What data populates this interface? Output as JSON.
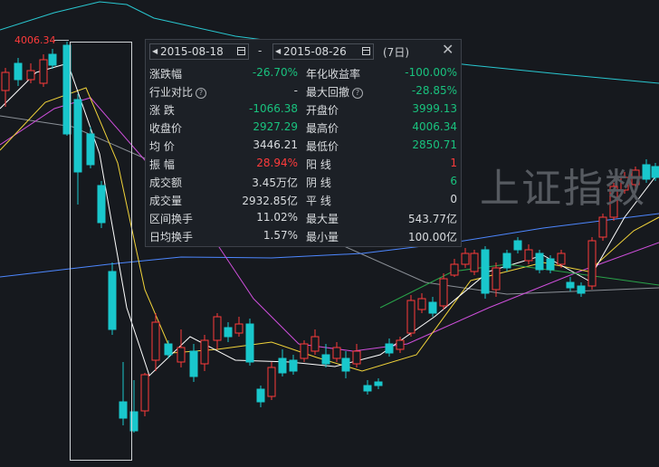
{
  "colors": {
    "up": "#ff3b3b",
    "down": "#19c7cc",
    "ma5": "#ffffff",
    "ma10": "#f2d43a",
    "ma20": "#cf4fdc",
    "ma60": "#4d87ff",
    "ma120": "#8a8f96",
    "ma250": "#29c7d0",
    "ma_green": "#2aa34a",
    "green_text": "#19c27e",
    "red_text": "#ff3b3b"
  },
  "chart": {
    "high_label": "4006.34",
    "watermark": "上证指数"
  },
  "panel": {
    "start_date": "2015-08-18",
    "end_date": "2015-08-26",
    "separator": "-",
    "days": "(7日)",
    "close_icon": "close-icon",
    "rows": [
      {
        "label": "涨跌幅",
        "value": "-26.70%",
        "value_color": "green",
        "label2": "年化收益率",
        "value2": "-100.00%",
        "value2_color": "green"
      },
      {
        "label": "行业对比",
        "help": true,
        "value": "-",
        "value_color": "white",
        "label2": "最大回撤",
        "help2": true,
        "value2": "-28.85%",
        "value2_color": "green"
      },
      {
        "label": "涨  跌",
        "value": "-1066.38",
        "value_color": "green",
        "label2": "开盘价",
        "value2": "3999.13",
        "value2_color": "green"
      },
      {
        "label": "收盘价",
        "value": "2927.29",
        "value_color": "green",
        "label2": "最高价",
        "value2": "4006.34",
        "value2_color": "green"
      },
      {
        "label": "均  价",
        "value": "3446.21",
        "value_color": "white",
        "label2": "最低价",
        "value2": "2850.71",
        "value2_color": "green"
      },
      {
        "label": "振  幅",
        "value": "28.94%",
        "value_color": "red",
        "label2": "阳  线",
        "value2": "1",
        "value2_color": "red"
      },
      {
        "label": "成交额",
        "value": "3.45万亿",
        "value_color": "white",
        "label2": "阴  线",
        "value2": "6",
        "value2_color": "green"
      },
      {
        "label": "成交量",
        "value": "2932.85亿",
        "value_color": "white",
        "label2": "平  线",
        "value2": "0",
        "value2_color": "white"
      },
      {
        "label": "区间换手",
        "value": "11.02%",
        "value_color": "white",
        "label2": "最大量",
        "value2": "543.77亿",
        "value2_color": "white"
      },
      {
        "label": "日均换手",
        "value": "1.57%",
        "value_color": "white",
        "label2": "最小量",
        "value2": "100.00亿",
        "value2_color": "white"
      }
    ]
  }
}
